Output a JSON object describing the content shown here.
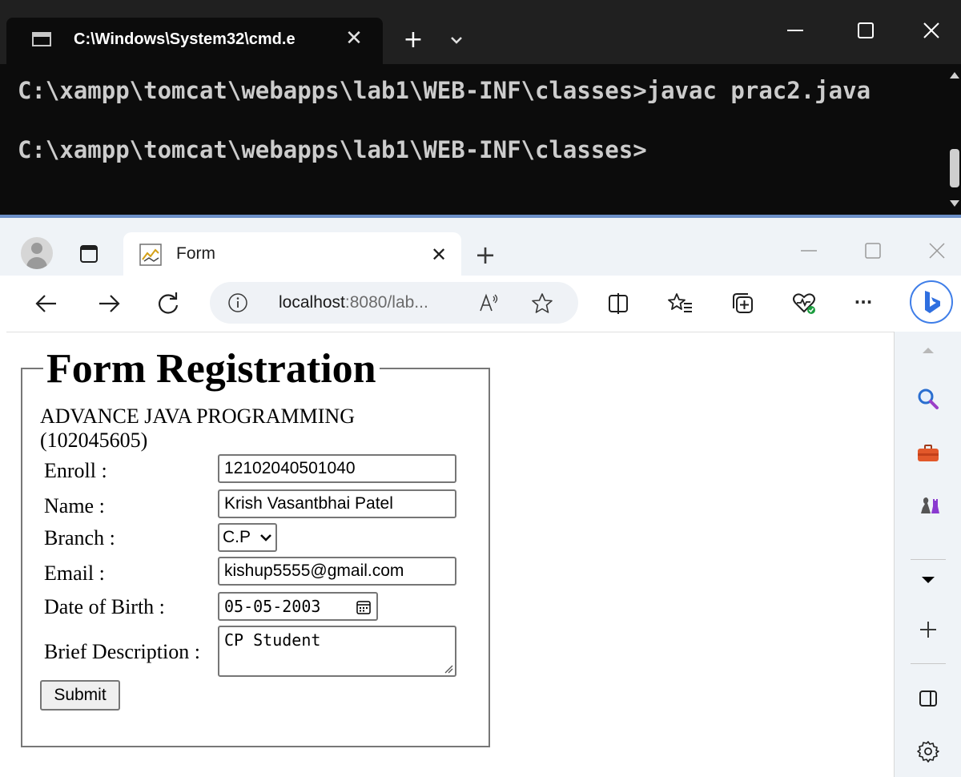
{
  "colors": {
    "terminal_bg": "#0c0c0c",
    "terminal_titlebar": "#202020",
    "terminal_text": "#cccccc",
    "browser_chrome": "#eff3f7",
    "copilot_accent": "#3f7ee8"
  },
  "terminal": {
    "tab_title": "C:\\Windows\\System32\\cmd.e",
    "tab_icon": "cmd-icon",
    "lines": [
      "C:\\xampp\\tomcat\\webapps\\lab1\\WEB-INF\\classes>javac prac2.java",
      "C:\\xampp\\tomcat\\webapps\\lab1\\WEB-INF\\classes>"
    ]
  },
  "browser": {
    "tab_title": "Form",
    "tab_favicon": "tomcat-icon",
    "address": {
      "host": "localhost",
      "rest": ":8080/lab..."
    },
    "toolbar_icons": [
      "back-icon",
      "forward-icon",
      "refresh-icon",
      "info-icon",
      "read-aloud-icon",
      "favorite-star-icon",
      "split-screen-icon",
      "favorites-icon",
      "collections-icon",
      "browser-essentials-icon",
      "more-icon",
      "copilot-icon"
    ],
    "sidebar_icons": [
      "scroll-up-icon",
      "search-icon",
      "tools-icon",
      "games-icon",
      "scroll-down-icon",
      "add-icon",
      "sidebar-toggle-icon",
      "settings-icon"
    ]
  },
  "form": {
    "legend": "Form Registration",
    "subtitle": "ADVANCE JAVA PROGRAMMING (102045605)",
    "enroll": {
      "label": "Enroll :",
      "value": "12102040501040"
    },
    "name": {
      "label": "Name :",
      "value": "Krish Vasantbhai Patel"
    },
    "branch": {
      "label": "Branch :",
      "selected": "C.P"
    },
    "email": {
      "label": "Email :",
      "value": "kishup5555@gmail.com"
    },
    "dob": {
      "label": "Date of Birth :",
      "value": "05-05-2003"
    },
    "description": {
      "label": "Brief Description :",
      "value": "CP Student"
    },
    "submit_label": "Submit"
  }
}
